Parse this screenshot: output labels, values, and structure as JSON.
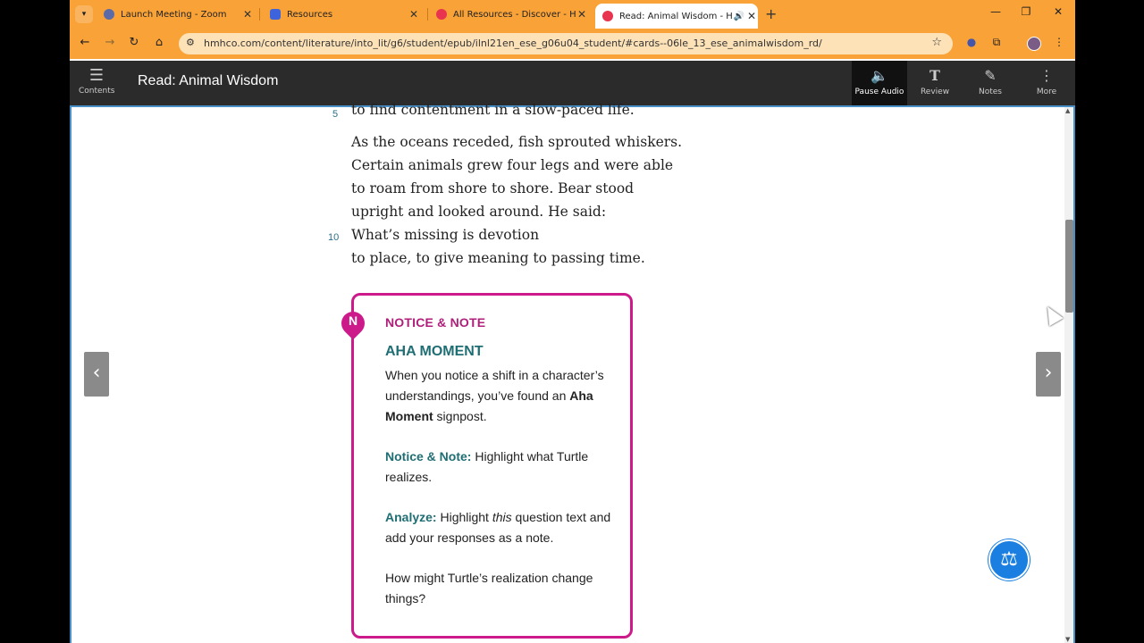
{
  "browser": {
    "tabs": [
      {
        "title": "Launch Meeting - Zoom",
        "favicon_color": "#5c6ba8",
        "active": false
      },
      {
        "title": "Resources",
        "favicon_color": "#3d63dd",
        "active": false
      },
      {
        "title": "All Resources - Discover - HMH",
        "favicon_color": "#e8344e",
        "active": false
      },
      {
        "title": "Read: Animal Wisdom - HM",
        "favicon_color": "#e8344e",
        "active": true
      }
    ],
    "url": "hmhco.com/content/literature/into_lit/g6/student/epub/ilnl21en_ese_g06u04_student/#cards--06le_13_ese_animalwisdom_rd/",
    "accent_color": "#f9a237"
  },
  "header": {
    "contents_label": "Contents",
    "title": "Read: Animal Wisdom",
    "buttons": [
      {
        "label": "Pause Audio",
        "icon": "speaker-icon"
      },
      {
        "label": "Review",
        "icon": "text-icon"
      },
      {
        "label": "Notes",
        "icon": "edit-icon"
      },
      {
        "label": "More",
        "icon": "more-icon"
      }
    ]
  },
  "poem": {
    "lines": [
      {
        "num": "5",
        "text": "to find contentment in a slow-paced life."
      },
      {
        "num": "",
        "text": "As the oceans receded, fish sprouted whiskers."
      },
      {
        "num": "",
        "text": "Certain animals grew four legs and were able"
      },
      {
        "num": "",
        "text": "to roam from shore to shore. Bear stood"
      },
      {
        "num": "",
        "text": "upright and looked around. He said:"
      },
      {
        "num": "10",
        "text": "What’s missing is devotion"
      },
      {
        "num": "",
        "text": "to place, to give meaning to passing time."
      }
    ]
  },
  "note_card": {
    "pin_letter": "N",
    "heading": "NOTICE & NOTE",
    "subheading": "AHA MOMENT",
    "body_pre": "When you notice a shift in a character’s understandings, you’ve found an ",
    "body_bold": "Aha Moment",
    "body_post": " signpost.",
    "notice_key": "Notice & Note:",
    "notice_text": " Highlight what Turtle realizes.",
    "analyze_key": "Analyze:",
    "analyze_pre": " Highlight ",
    "analyze_em": "this",
    "analyze_post": " question text and add your responses as a note.",
    "question": "How might Turtle’s realization change things?",
    "border_color": "#cc1a8a"
  },
  "nav": {
    "prev_icon": "chevron-left-icon",
    "next_icon": "chevron-right-icon"
  },
  "fab_icon": "scale-icon"
}
